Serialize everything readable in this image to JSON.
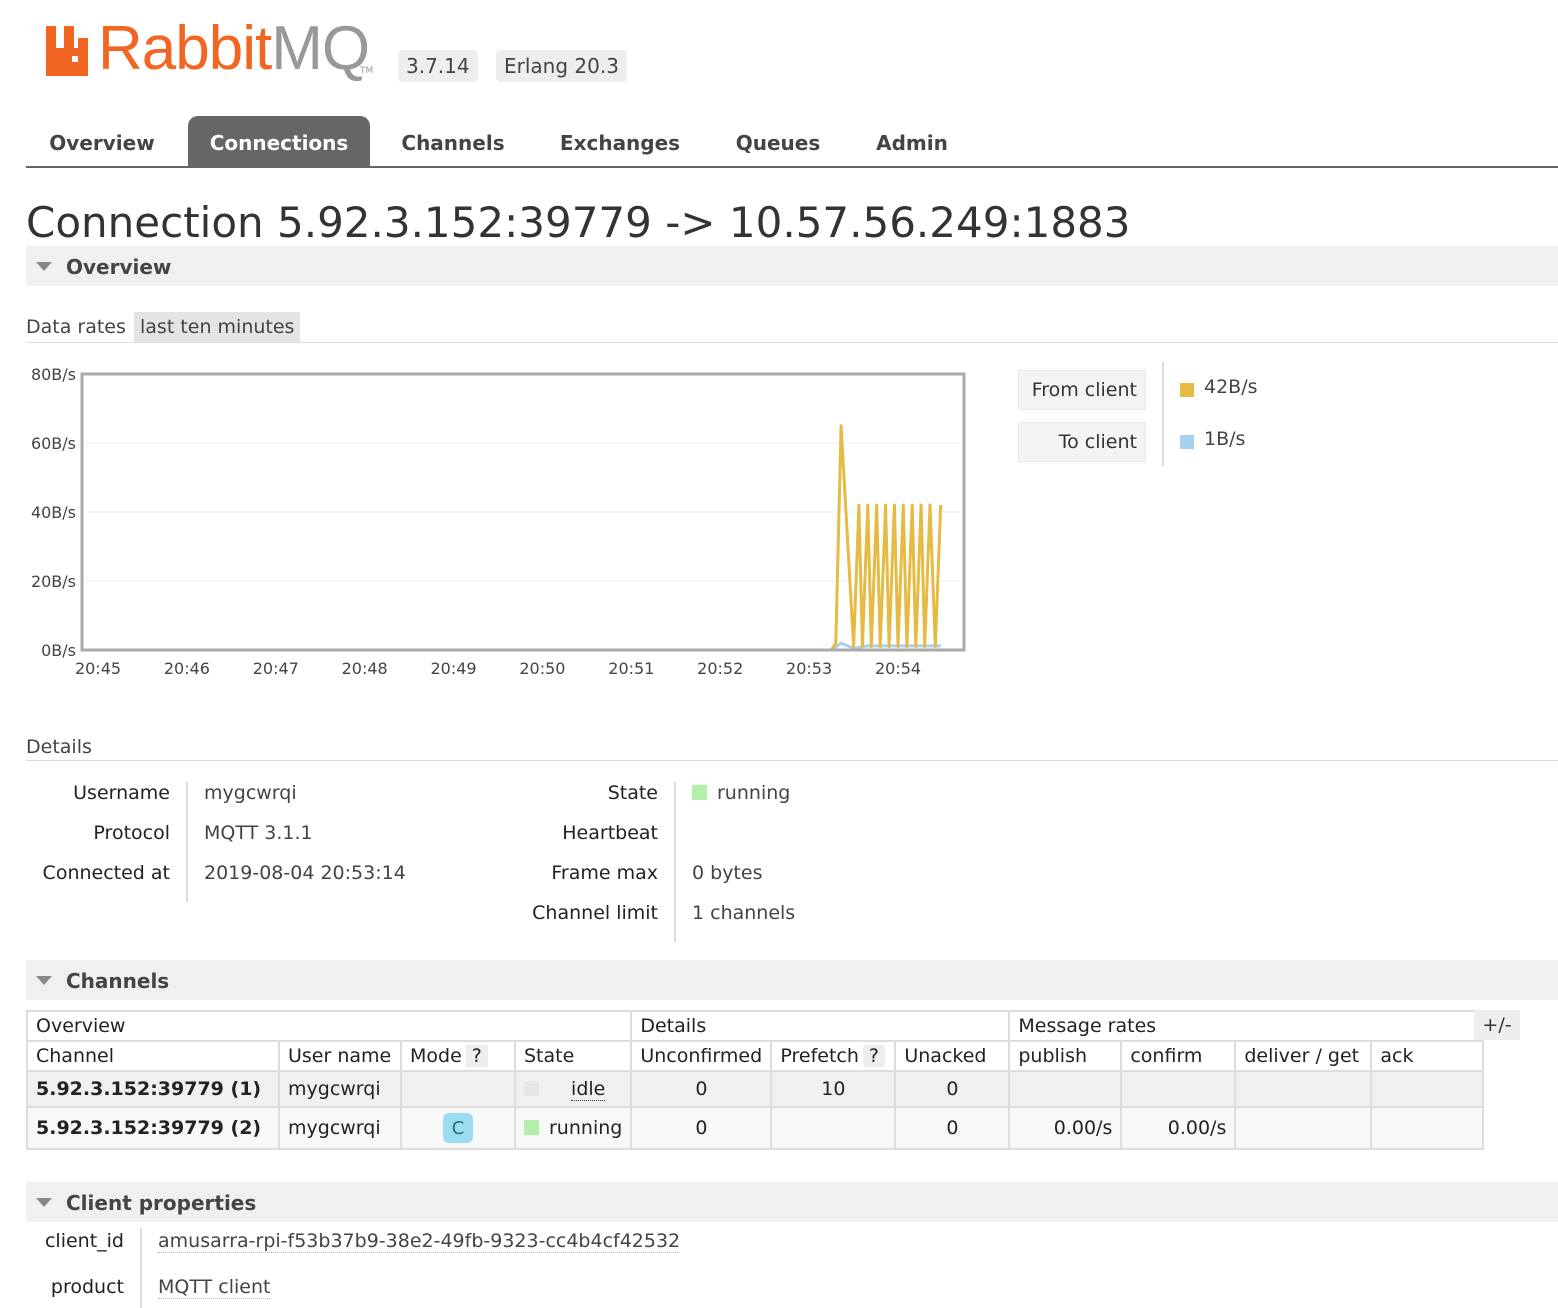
{
  "header": {
    "brand_rabbit": "RabbitMQ",
    "brand_tm": "TM",
    "version": "3.7.14",
    "erlang": "Erlang 20.3"
  },
  "nav": {
    "tabs": [
      "Overview",
      "Connections",
      "Channels",
      "Exchanges",
      "Queues",
      "Admin"
    ],
    "active": "Connections"
  },
  "page_title": "Connection 5.92.3.152:39779 -> 10.57.56.249:1883",
  "overview_section": {
    "label": "Overview",
    "data_rates_label": "Data rates",
    "rate_range": "last ten minutes"
  },
  "chart_data": {
    "type": "line",
    "x": [
      "20:45",
      "20:46",
      "20:47",
      "20:48",
      "20:49",
      "20:50",
      "20:51",
      "20:52",
      "20:53",
      "20:54"
    ],
    "ytick_labels": [
      "80B/s",
      "60B/s",
      "40B/s",
      "20B/s",
      "0B/s"
    ],
    "ylim": [
      0,
      80
    ],
    "grid": true,
    "legend_position": "right",
    "series": [
      {
        "name": "From client",
        "color": "#e5bb46",
        "current": "42B/s",
        "points": [
          [
            0,
            0
          ],
          [
            8.25,
            0
          ],
          [
            8.3,
            2
          ],
          [
            8.36,
            65
          ],
          [
            8.5,
            1
          ],
          [
            8.56,
            42
          ],
          [
            8.6,
            1
          ],
          [
            8.66,
            42
          ],
          [
            8.7,
            1
          ],
          [
            8.76,
            42
          ],
          [
            8.8,
            1
          ],
          [
            8.86,
            42
          ],
          [
            8.9,
            1
          ],
          [
            8.96,
            42
          ],
          [
            9.0,
            1
          ],
          [
            9.06,
            42
          ],
          [
            9.1,
            1
          ],
          [
            9.16,
            42
          ],
          [
            9.2,
            1
          ],
          [
            9.26,
            42
          ],
          [
            9.3,
            1
          ],
          [
            9.36,
            42
          ],
          [
            9.42,
            1
          ],
          [
            9.48,
            42
          ]
        ]
      },
      {
        "name": "To client",
        "color": "#a9d0f0",
        "current": "1B/s",
        "points": [
          [
            0,
            0
          ],
          [
            8.25,
            0
          ],
          [
            8.36,
            2
          ],
          [
            8.5,
            0.5
          ],
          [
            8.66,
            1.2
          ],
          [
            8.86,
            1.2
          ],
          [
            9.06,
            1.2
          ],
          [
            9.26,
            1.2
          ],
          [
            9.48,
            1.2
          ]
        ]
      }
    ]
  },
  "details": {
    "label": "Details",
    "username_label": "Username",
    "username": "mygcwrqi",
    "protocol_label": "Protocol",
    "protocol": "MQTT 3.1.1",
    "connected_label": "Connected at",
    "connected": "2019-08-04 20:53:14",
    "state_label": "State",
    "state": "running",
    "state_color": "#b2f0a8",
    "heartbeat_label": "Heartbeat",
    "heartbeat": "",
    "framemax_label": "Frame max",
    "framemax": "0 bytes",
    "chanlimit_label": "Channel limit",
    "chanlimit": "1 channels"
  },
  "channels_section": {
    "label": "Channels",
    "toggle_label": "+/-",
    "group_headers": [
      "Overview",
      "Details",
      "Message rates"
    ],
    "columns": [
      "Channel",
      "User name",
      "Mode",
      "State",
      "Unconfirmed",
      "Prefetch",
      "Unacked",
      "publish",
      "confirm",
      "deliver / get",
      "ack"
    ],
    "help_mark": "?",
    "rows": [
      {
        "channel": "5.92.3.152:39779 (1)",
        "user": "mygcwrqi",
        "mode": "",
        "state": "idle",
        "state_color": "#e6e6e6",
        "unconfirmed": "0",
        "prefetch": "10",
        "unacked": "0",
        "publish": "",
        "confirm": "",
        "deliver": "",
        "ack": ""
      },
      {
        "channel": "5.92.3.152:39779 (2)",
        "user": "mygcwrqi",
        "mode": "C",
        "state": "running",
        "state_color": "#b2f0a8",
        "unconfirmed": "0",
        "prefetch": "",
        "unacked": "0",
        "publish": "0.00/s",
        "confirm": "0.00/s",
        "deliver": "",
        "ack": ""
      }
    ]
  },
  "client_properties": {
    "label": "Client properties",
    "client_id_label": "client_id",
    "client_id": "amusarra-rpi-f53b37b9-38e2-49fb-9323-cc4b4cf42532",
    "product_label": "product",
    "product": "MQTT client"
  }
}
